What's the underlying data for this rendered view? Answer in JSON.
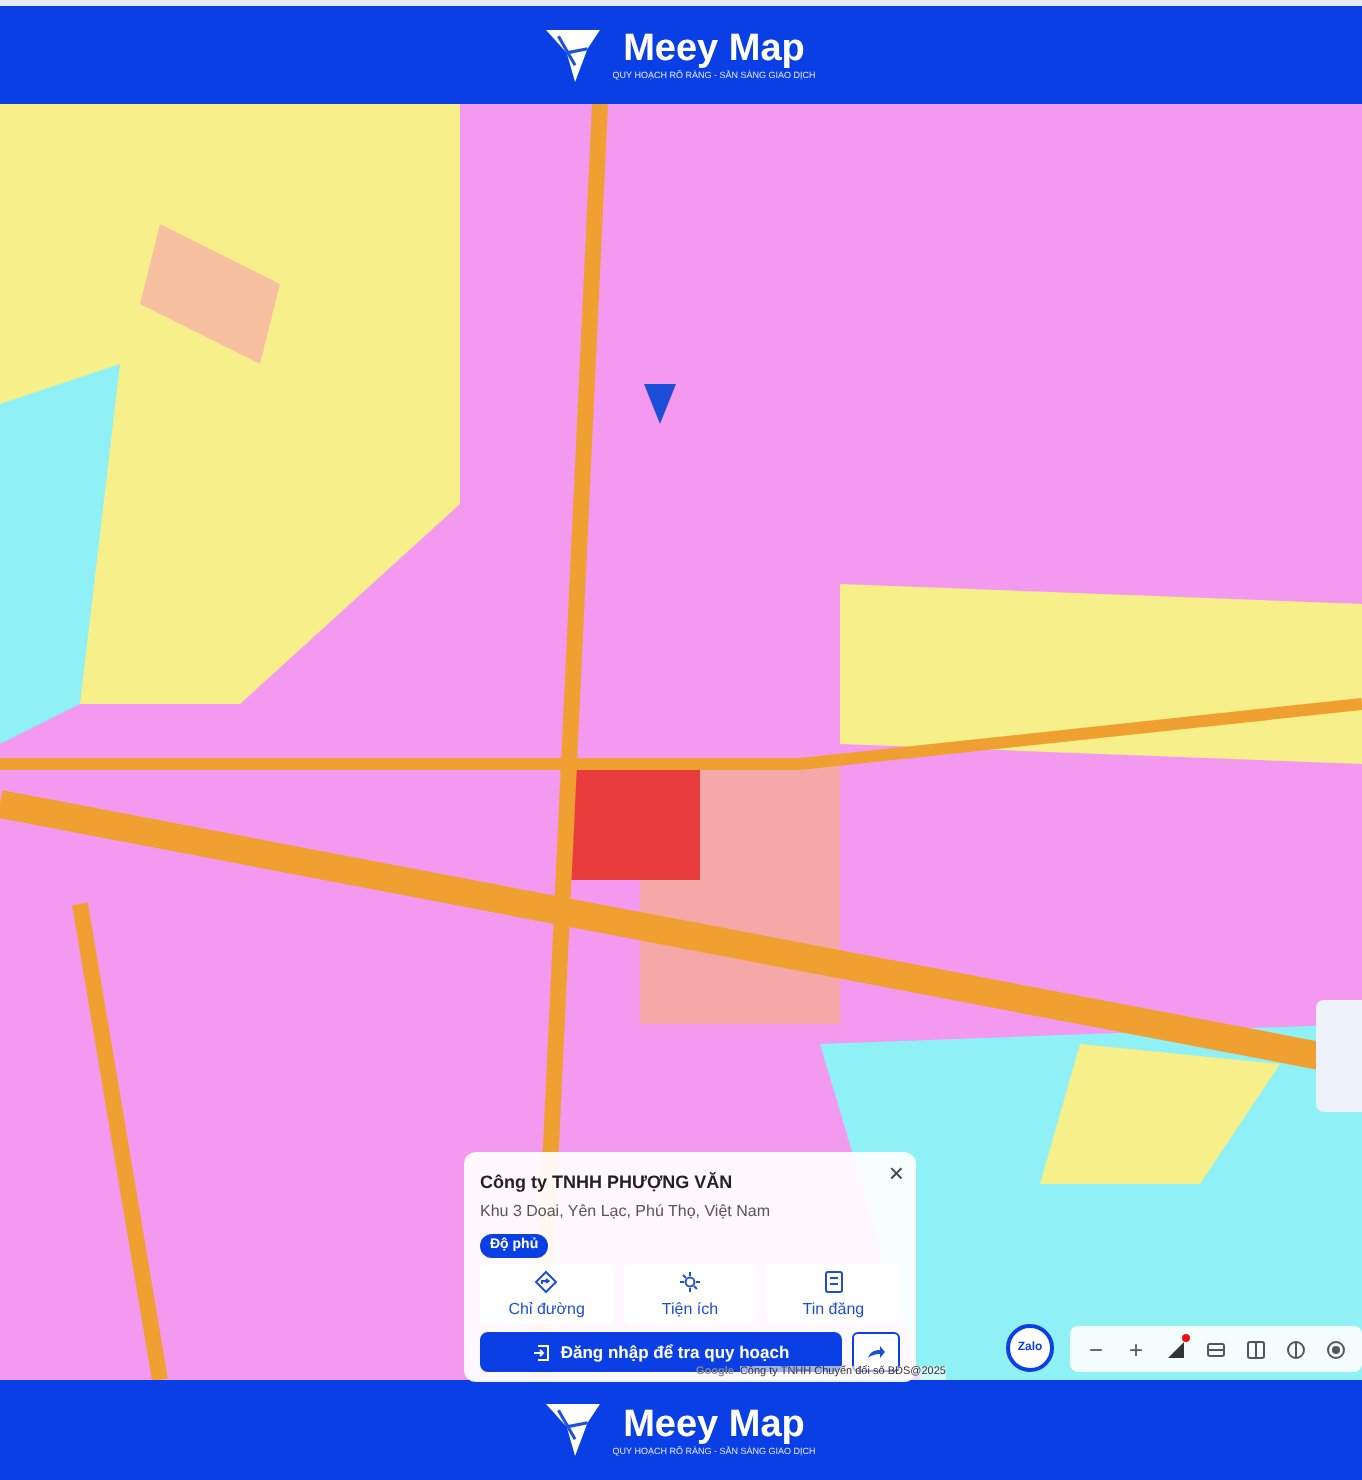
{
  "header": {
    "brand": "Meey Map",
    "tagline": "QUY HOẠCH RÕ RÀNG - SẴN SÀNG GIAO DỊCH"
  },
  "place_card": {
    "title": "Công ty TNHH PHƯỢNG VĂN",
    "address": "Khu 3 Doai, Yên Lạc, Phú Thọ, Việt Nam",
    "badge": "Độ phủ",
    "close": "×",
    "actions": [
      {
        "kind": "directions",
        "label": "Chỉ đường"
      },
      {
        "kind": "amenities",
        "label": "Tiện ích"
      },
      {
        "kind": "listings",
        "label": "Tin đăng"
      }
    ],
    "login_button": "Đăng nhập để tra quy hoạch"
  },
  "attribution": {
    "google": "Google",
    "text": "Công ty TNHH Chuyển đổi số BĐS@2025"
  },
  "zalo": "Zalo",
  "map_controls": [
    {
      "kind": "zoom_out",
      "label": "−"
    },
    {
      "kind": "zoom_in",
      "label": "+"
    },
    {
      "kind": "layers",
      "alert": true
    },
    {
      "kind": "panel",
      "alert": false
    },
    {
      "kind": "split",
      "alert": false
    },
    {
      "kind": "compare",
      "alert": false
    },
    {
      "kind": "locate",
      "alert": false
    }
  ],
  "footer": {
    "brand": "Meey Map",
    "tagline": "QUY HOẠCH RÕ RÀNG - SẴN SÀNG GIAO DỊCH"
  }
}
